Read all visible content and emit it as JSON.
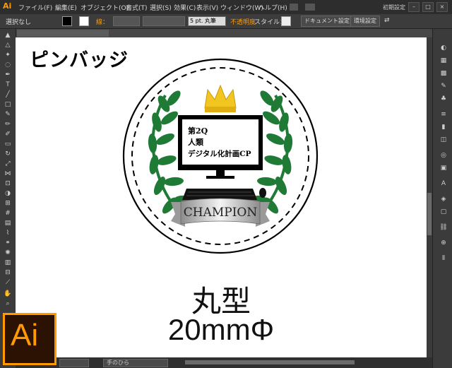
{
  "app": {
    "logo": "Ai",
    "workspace": "初期設定"
  },
  "menu": [
    "ファイル(F)",
    "編集(E)",
    "オブジェクト(O)",
    "書式(T)",
    "選択(S)",
    "効果(C)",
    "表示(V)",
    "ウィンドウ(W)",
    "ヘルプ(H)"
  ],
  "control": {
    "selection": "選択なし",
    "stroke_label": "線：",
    "brush": "5 pt. 丸筆",
    "opacity_label": "不透明度",
    "style_label": "スタイル：",
    "doc_settings": "ドキュメント設定",
    "env_settings": "環境設定"
  },
  "artboard": {
    "title": "ピンバッジ",
    "badge": {
      "screen_lines": [
        "第2Q",
        "人類",
        "デジタル化計画CP"
      ],
      "ribbon": "CHAMPION"
    },
    "shape": "丸型",
    "size": "20mmΦ"
  },
  "status": {
    "tool": "手のひら"
  },
  "colors": {
    "laurel": "#1f7a35",
    "crown": "#f2c521",
    "accent": "#ff9a00"
  }
}
